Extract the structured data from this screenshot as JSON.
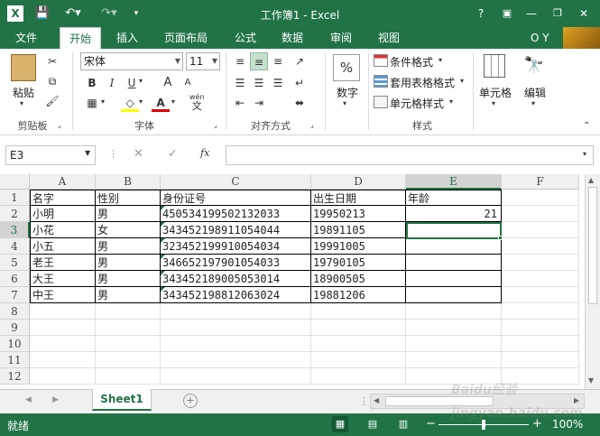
{
  "title": "工作簿1 - Excel",
  "tabs": {
    "file": "文件",
    "home": "开始",
    "insert": "插入",
    "layout": "页面布局",
    "formulas": "公式",
    "data": "数据",
    "review": "审阅",
    "view": "视图"
  },
  "user": "O Y",
  "ribbon": {
    "paste": "粘贴",
    "font_name": "宋体",
    "font_size": "11",
    "bold": "B",
    "italic": "I",
    "underline": "U",
    "wen": "wén",
    "wen2": "文",
    "big_a": "A",
    "small_a": "A",
    "font_color": "A",
    "number": "数字",
    "cond_format": "条件格式",
    "table_format": "套用表格格式",
    "cell_style": "单元格样式",
    "cells": "单元格",
    "edit": "编辑",
    "percent": "%",
    "groups": {
      "clipboard": "剪贴板",
      "font": "字体",
      "align": "对齐方式",
      "styles": "样式"
    }
  },
  "formula_bar": {
    "name_box": "E3",
    "fx": "fx",
    "cancel": "✕",
    "enter": "✓",
    "content": ""
  },
  "columns": [
    "A",
    "B",
    "C",
    "D",
    "E",
    "F"
  ],
  "rows": [
    "1",
    "2",
    "3",
    "4",
    "5",
    "6",
    "7",
    "8",
    "9",
    "10",
    "11",
    "12"
  ],
  "table": [
    [
      "名字",
      "性别",
      "身份证号",
      "出生日期",
      "年龄"
    ],
    [
      "小明",
      "男",
      "450534199502132033",
      "19950213",
      "21"
    ],
    [
      "小花",
      "女",
      "343452198911054044",
      "19891105",
      ""
    ],
    [
      "小五",
      "男",
      "323452199910054034",
      "19991005",
      ""
    ],
    [
      "老王",
      "男",
      "346652197901054033",
      "19790105",
      ""
    ],
    [
      "大王",
      "男",
      "343452189005053014",
      "18900505",
      ""
    ],
    [
      "中王",
      "男",
      "343452198812063024",
      "19881206",
      ""
    ]
  ],
  "sheet_tab": "Sheet1",
  "status": {
    "ready": "就绪",
    "zoom": "100%"
  },
  "watermark": "Baidu经验 jingyan.baidu.com",
  "colors": {
    "excel_green": "#217346",
    "selection": "#217346"
  }
}
